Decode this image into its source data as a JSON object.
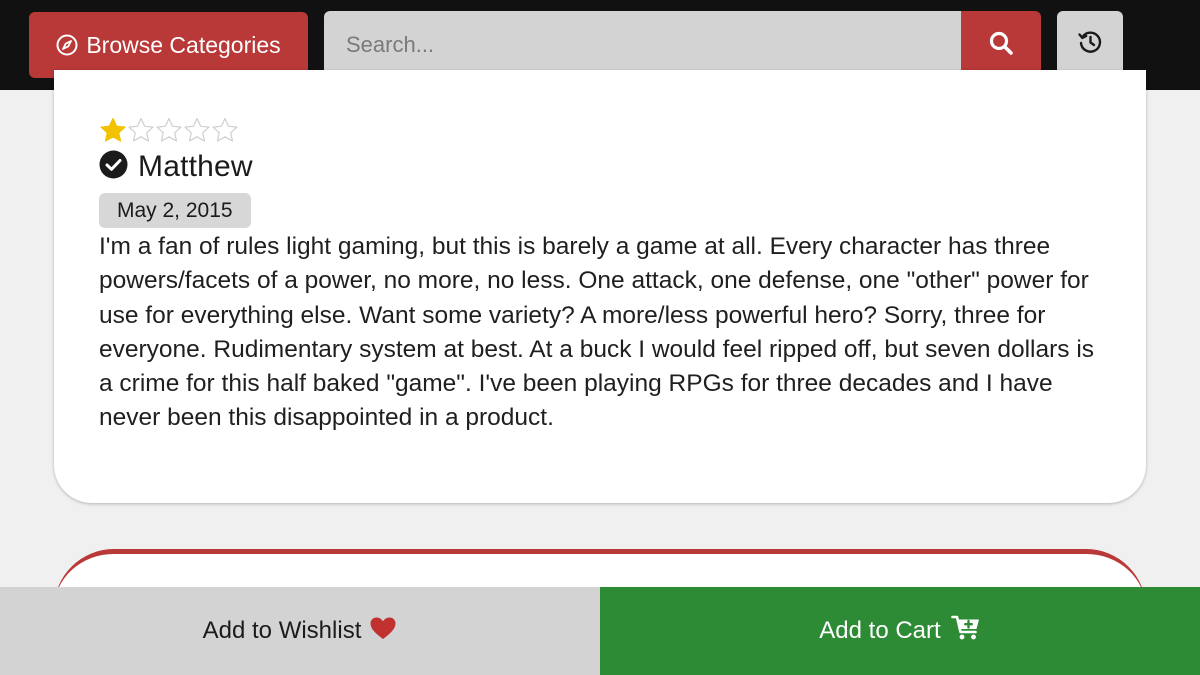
{
  "header": {
    "browse_label": "Browse Categories",
    "search_placeholder": "Search...",
    "search_icon": "magnifier-icon",
    "history_icon": "history-icon",
    "browse_icon": "compass-icon"
  },
  "review": {
    "rating": 1,
    "max_rating": 5,
    "reviewer": "Matthew",
    "verified_icon": "check-circle-icon",
    "date": "May 2, 2015",
    "text": "I'm a fan of rules light gaming, but this is barely a game at all. Every character has three powers/facets of a power, no more, no less. One attack, one defense, one \"other\" power for use for everything else. Want some variety? A more/less powerful hero? Sorry, three for everyone. Rudimentary system at best. At a buck I would feel ripped off, but seven dollars is a crime for this half baked \"game\". I've been playing RPGs for three decades and I have never been this disappointed in a product."
  },
  "footer": {
    "wishlist_label": "Add to Wishlist",
    "wishlist_icon": "heart-icon",
    "cart_label": "Add to Cart",
    "cart_icon": "cart-plus-icon"
  },
  "colors": {
    "brand_red": "#b93838",
    "cart_green": "#2e8b35",
    "star_gold": "#f2c200"
  }
}
